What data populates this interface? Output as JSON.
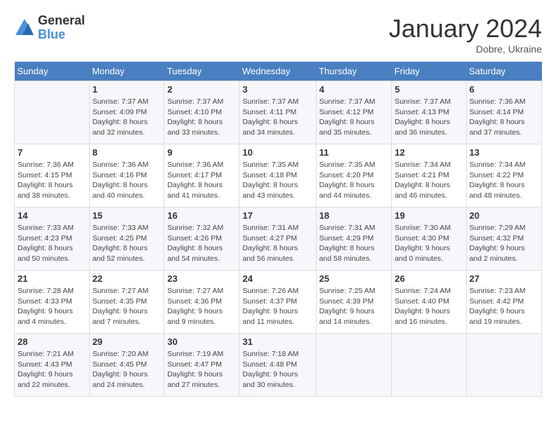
{
  "logo": {
    "general": "General",
    "blue": "Blue"
  },
  "title": "January 2024",
  "location": "Dobre, Ukraine",
  "days_of_week": [
    "Sunday",
    "Monday",
    "Tuesday",
    "Wednesday",
    "Thursday",
    "Friday",
    "Saturday"
  ],
  "weeks": [
    [
      {
        "day": "",
        "info": ""
      },
      {
        "day": "1",
        "info": "Sunrise: 7:37 AM\nSunset: 4:09 PM\nDaylight: 8 hours\nand 32 minutes."
      },
      {
        "day": "2",
        "info": "Sunrise: 7:37 AM\nSunset: 4:10 PM\nDaylight: 8 hours\nand 33 minutes."
      },
      {
        "day": "3",
        "info": "Sunrise: 7:37 AM\nSunset: 4:11 PM\nDaylight: 8 hours\nand 34 minutes."
      },
      {
        "day": "4",
        "info": "Sunrise: 7:37 AM\nSunset: 4:12 PM\nDaylight: 8 hours\nand 35 minutes."
      },
      {
        "day": "5",
        "info": "Sunrise: 7:37 AM\nSunset: 4:13 PM\nDaylight: 8 hours\nand 36 minutes."
      },
      {
        "day": "6",
        "info": "Sunrise: 7:36 AM\nSunset: 4:14 PM\nDaylight: 8 hours\nand 37 minutes."
      }
    ],
    [
      {
        "day": "7",
        "info": "Sunrise: 7:36 AM\nSunset: 4:15 PM\nDaylight: 8 hours\nand 38 minutes."
      },
      {
        "day": "8",
        "info": "Sunrise: 7:36 AM\nSunset: 4:16 PM\nDaylight: 8 hours\nand 40 minutes."
      },
      {
        "day": "9",
        "info": "Sunrise: 7:36 AM\nSunset: 4:17 PM\nDaylight: 8 hours\nand 41 minutes."
      },
      {
        "day": "10",
        "info": "Sunrise: 7:35 AM\nSunset: 4:18 PM\nDaylight: 8 hours\nand 43 minutes."
      },
      {
        "day": "11",
        "info": "Sunrise: 7:35 AM\nSunset: 4:20 PM\nDaylight: 8 hours\nand 44 minutes."
      },
      {
        "day": "12",
        "info": "Sunrise: 7:34 AM\nSunset: 4:21 PM\nDaylight: 8 hours\nand 46 minutes."
      },
      {
        "day": "13",
        "info": "Sunrise: 7:34 AM\nSunset: 4:22 PM\nDaylight: 8 hours\nand 48 minutes."
      }
    ],
    [
      {
        "day": "14",
        "info": "Sunrise: 7:33 AM\nSunset: 4:23 PM\nDaylight: 8 hours\nand 50 minutes."
      },
      {
        "day": "15",
        "info": "Sunrise: 7:33 AM\nSunset: 4:25 PM\nDaylight: 8 hours\nand 52 minutes."
      },
      {
        "day": "16",
        "info": "Sunrise: 7:32 AM\nSunset: 4:26 PM\nDaylight: 8 hours\nand 54 minutes."
      },
      {
        "day": "17",
        "info": "Sunrise: 7:31 AM\nSunset: 4:27 PM\nDaylight: 8 hours\nand 56 minutes."
      },
      {
        "day": "18",
        "info": "Sunrise: 7:31 AM\nSunset: 4:29 PM\nDaylight: 8 hours\nand 58 minutes."
      },
      {
        "day": "19",
        "info": "Sunrise: 7:30 AM\nSunset: 4:30 PM\nDaylight: 9 hours\nand 0 minutes."
      },
      {
        "day": "20",
        "info": "Sunrise: 7:29 AM\nSunset: 4:32 PM\nDaylight: 9 hours\nand 2 minutes."
      }
    ],
    [
      {
        "day": "21",
        "info": "Sunrise: 7:28 AM\nSunset: 4:33 PM\nDaylight: 9 hours\nand 4 minutes."
      },
      {
        "day": "22",
        "info": "Sunrise: 7:27 AM\nSunset: 4:35 PM\nDaylight: 9 hours\nand 7 minutes."
      },
      {
        "day": "23",
        "info": "Sunrise: 7:27 AM\nSunset: 4:36 PM\nDaylight: 9 hours\nand 9 minutes."
      },
      {
        "day": "24",
        "info": "Sunrise: 7:26 AM\nSunset: 4:37 PM\nDaylight: 9 hours\nand 11 minutes."
      },
      {
        "day": "25",
        "info": "Sunrise: 7:25 AM\nSunset: 4:39 PM\nDaylight: 9 hours\nand 14 minutes."
      },
      {
        "day": "26",
        "info": "Sunrise: 7:24 AM\nSunset: 4:40 PM\nDaylight: 9 hours\nand 16 minutes."
      },
      {
        "day": "27",
        "info": "Sunrise: 7:23 AM\nSunset: 4:42 PM\nDaylight: 9 hours\nand 19 minutes."
      }
    ],
    [
      {
        "day": "28",
        "info": "Sunrise: 7:21 AM\nSunset: 4:43 PM\nDaylight: 9 hours\nand 22 minutes."
      },
      {
        "day": "29",
        "info": "Sunrise: 7:20 AM\nSunset: 4:45 PM\nDaylight: 9 hours\nand 24 minutes."
      },
      {
        "day": "30",
        "info": "Sunrise: 7:19 AM\nSunset: 4:47 PM\nDaylight: 9 hours\nand 27 minutes."
      },
      {
        "day": "31",
        "info": "Sunrise: 7:18 AM\nSunset: 4:48 PM\nDaylight: 9 hours\nand 30 minutes."
      },
      {
        "day": "",
        "info": ""
      },
      {
        "day": "",
        "info": ""
      },
      {
        "day": "",
        "info": ""
      }
    ]
  ]
}
